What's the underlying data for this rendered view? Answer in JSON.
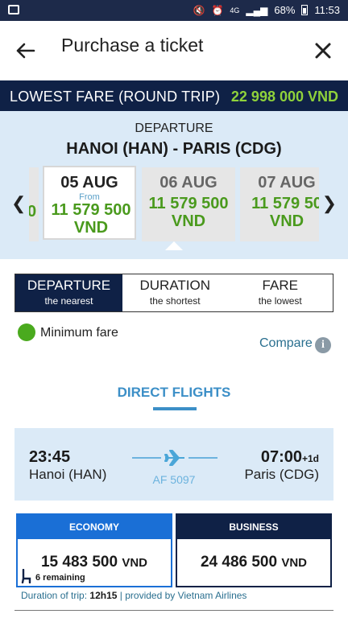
{
  "status_bar": {
    "battery": "68%",
    "time": "11:53",
    "network": "4G"
  },
  "header": {
    "title": "Purchase a ticket"
  },
  "fare_bar": {
    "label": "LOWEST FARE (ROUND TRIP)",
    "value": "22 998 000 VND"
  },
  "departure": {
    "label": "DEPARTURE",
    "route": "HANOI (HAN) - PARIS (CDG)",
    "partial_card_text": "0",
    "dates": [
      {
        "date": "05 AUG",
        "from": "From",
        "price": "11 579 500",
        "currency": "VND",
        "selected": true
      },
      {
        "date": "06 AUG",
        "price": "11 579 500",
        "currency": "VND",
        "selected": false
      },
      {
        "date": "07 AUG",
        "price": "11 579 50",
        "currency": "VND",
        "selected": false
      }
    ]
  },
  "sort_tabs": [
    {
      "main": "DEPARTURE",
      "sub": "the nearest",
      "active": true
    },
    {
      "main": "DURATION",
      "sub": "the shortest",
      "active": false
    },
    {
      "main": "FARE",
      "sub": "the lowest",
      "active": false
    }
  ],
  "legend": {
    "min_fare": "Minimum fare",
    "compare": "Compare",
    "colors": {
      "min_fare_dot": "#4aaa1e"
    }
  },
  "section": {
    "title": "DIRECT FLIGHTS"
  },
  "flight": {
    "dep_time": "23:45",
    "dep_city": "Hanoi (HAN)",
    "arr_time": "07:00",
    "arr_suffix": "+1d",
    "arr_city": "Paris (CDG)",
    "code": "AF 5097"
  },
  "classes": {
    "economy": {
      "label": "ECONOMY",
      "price": "15 483 500",
      "currency": "VND",
      "remaining": "6 remaining"
    },
    "business": {
      "label": "BUSINESS",
      "price": "24 486 500",
      "currency": "VND"
    }
  },
  "footer": {
    "duration_label": "Duration of trip:",
    "duration": "12h15",
    "sep": "|",
    "provider": "provided by Vietnam Airlines"
  }
}
